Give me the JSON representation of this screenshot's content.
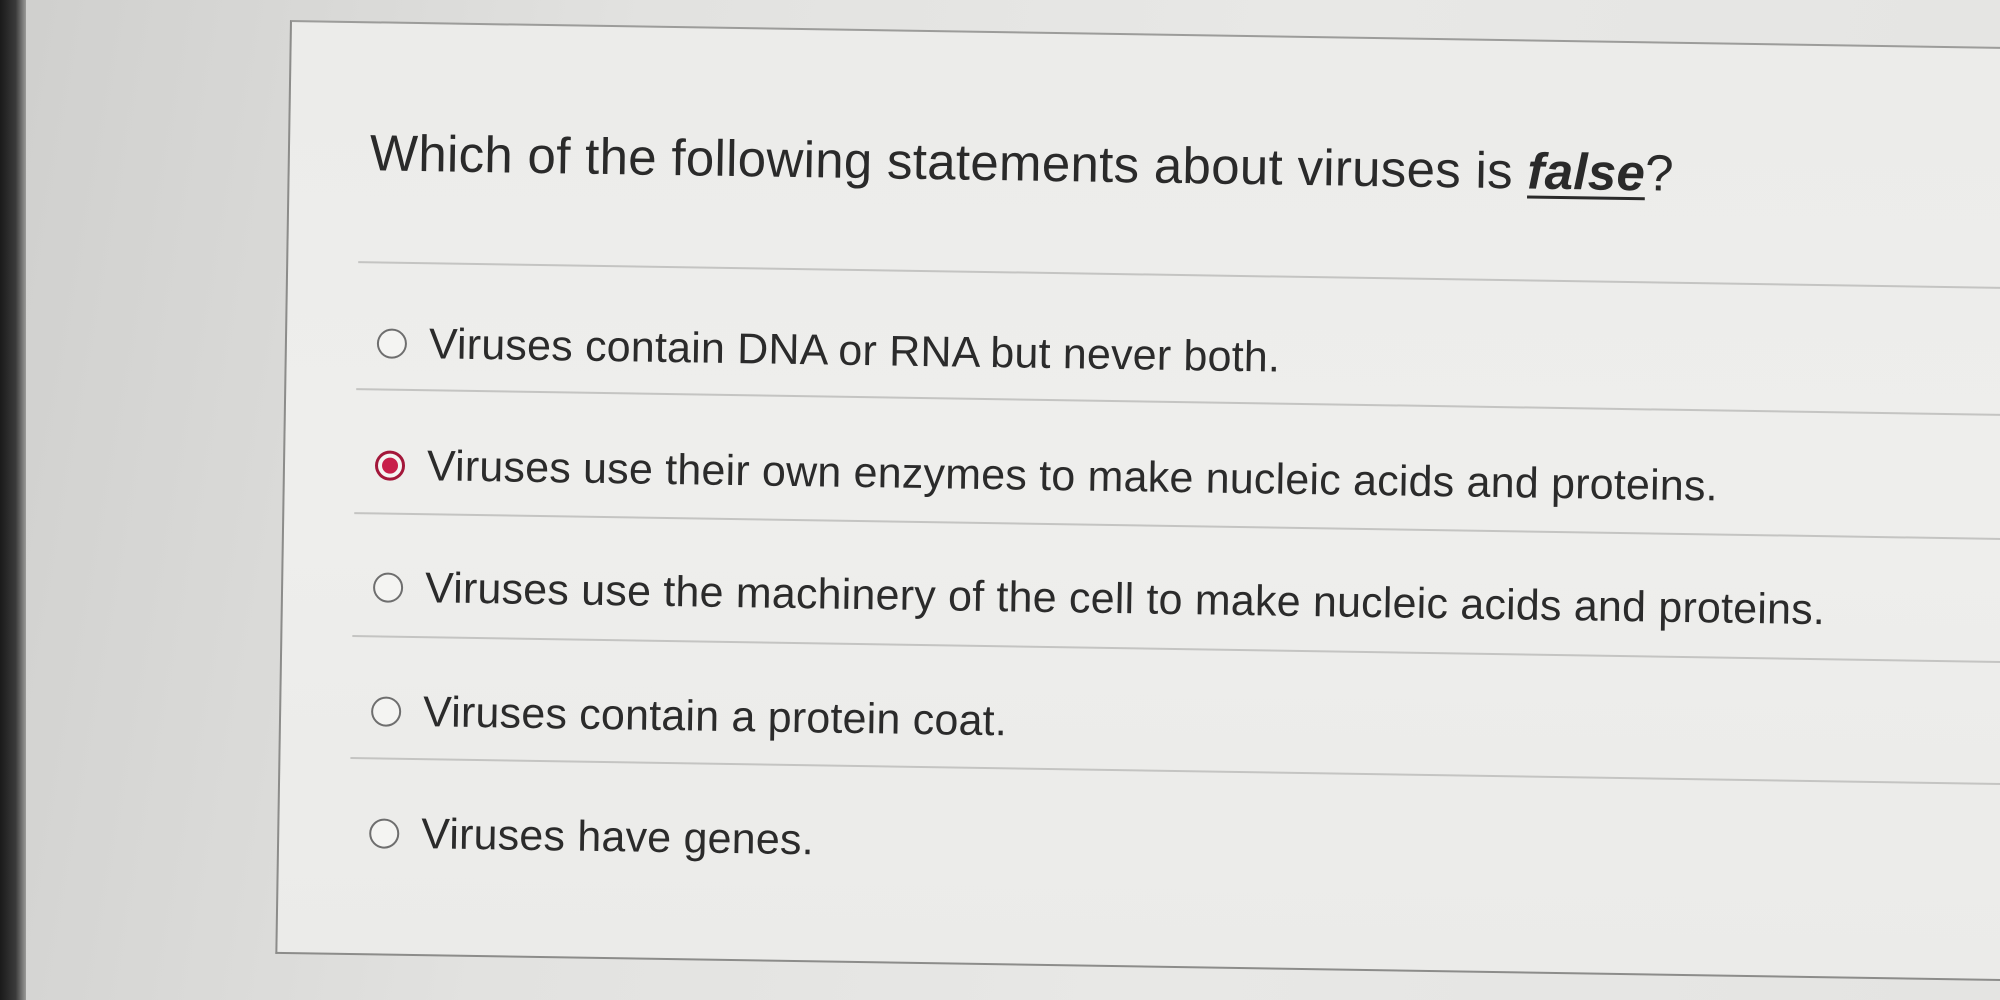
{
  "question": {
    "text_before": "Which of the following statements about viruses is ",
    "emphasis": "false",
    "text_after": "?"
  },
  "options": [
    {
      "label": "Viruses contain DNA or RNA but never both.",
      "selected": false
    },
    {
      "label": "Viruses use their own enzymes to make nucleic acids and proteins.",
      "selected": true
    },
    {
      "label": "Viruses use the machinery of the cell to make nucleic acids and proteins.",
      "selected": false
    },
    {
      "label": "Viruses contain a protein coat.",
      "selected": false
    },
    {
      "label": "Viruses have genes.",
      "selected": false
    }
  ],
  "colors": {
    "selected_radio": "#c81f4a",
    "text": "#2b2b2b"
  }
}
